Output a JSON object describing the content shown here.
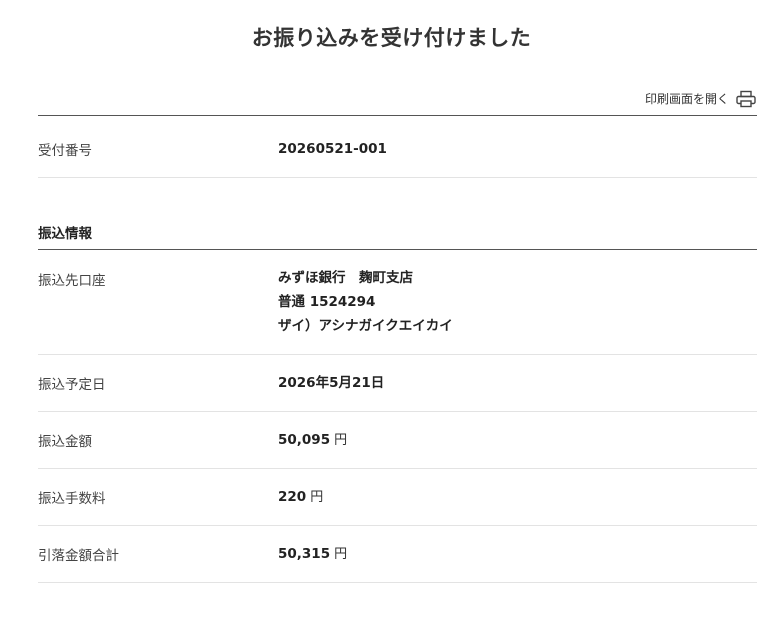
{
  "page": {
    "title": "お振り込みを受け付けました",
    "print_label": "印刷画面を開く"
  },
  "receipt": {
    "label": "受付番号",
    "value": "20260521-001"
  },
  "section": {
    "title": "振込情報"
  },
  "details": {
    "account": {
      "label": "振込先口座",
      "bank": "みずほ銀行　麹町支店",
      "account_no": "普通 1524294",
      "holder": "ザイ）アシナガイクエイカイ"
    },
    "date": {
      "label": "振込予定日",
      "value": "2026年5月21日"
    },
    "amount": {
      "label": "振込金額",
      "value": "50,095",
      "unit": "円"
    },
    "fee": {
      "label": "振込手数料",
      "value": "220",
      "unit": "円"
    },
    "total": {
      "label": "引落金額合計",
      "value": "50,315",
      "unit": "円"
    }
  }
}
